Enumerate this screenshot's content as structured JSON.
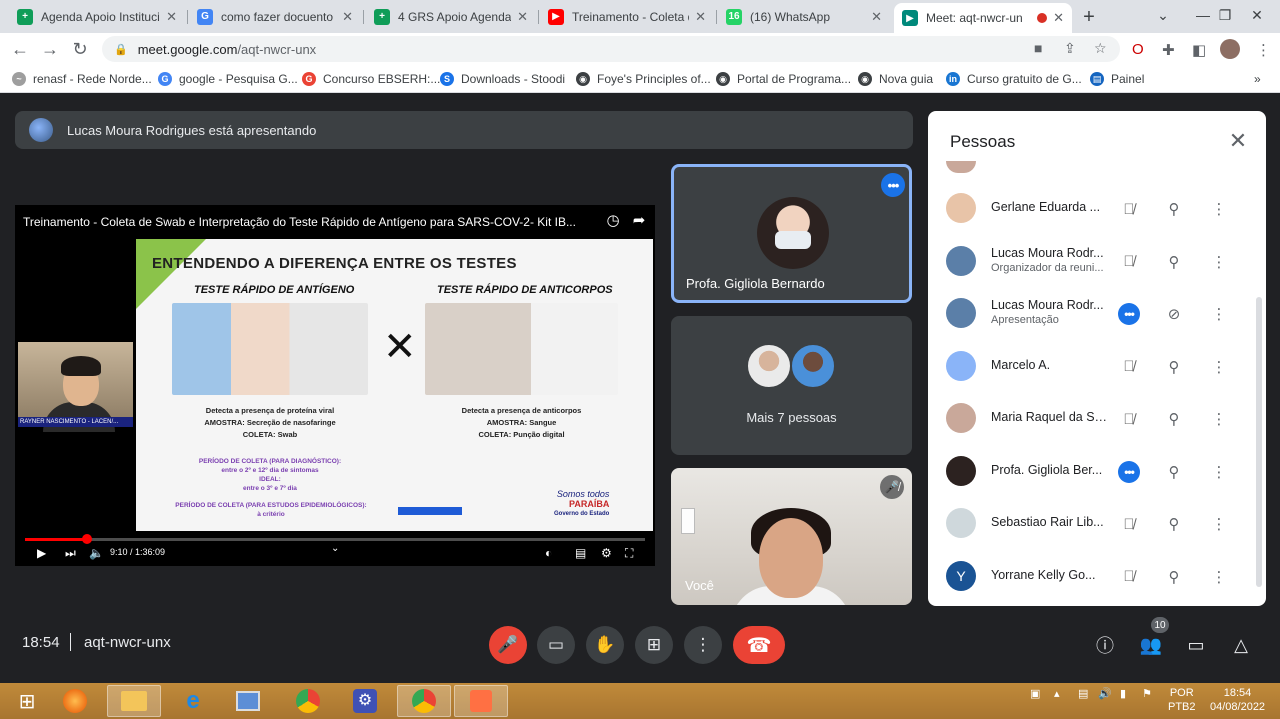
{
  "browser": {
    "tabs": [
      {
        "title": "Agenda Apoio Instituci",
        "favicon": "sheets-icon",
        "color": "#0f9d58",
        "glyph": "+"
      },
      {
        "title": "como fazer docuento d",
        "favicon": "google-icon",
        "color": "#4285f4",
        "glyph": "G"
      },
      {
        "title": "4 GRS Apoio Agenda co",
        "favicon": "sheets-icon",
        "color": "#0f9d58",
        "glyph": "+"
      },
      {
        "title": "Treinamento - Coleta de",
        "favicon": "youtube-icon",
        "color": "#ff0000",
        "glyph": "▶"
      },
      {
        "title": "(16) WhatsApp",
        "favicon": "whatsapp-icon",
        "color": "#25d366",
        "glyph": "16"
      },
      {
        "title": "Meet: aqt-nwcr-un",
        "favicon": "meet-icon",
        "color": "#00897b",
        "glyph": "▶"
      }
    ],
    "url_host": "meet.google.com",
    "url_path": "/aqt-nwcr-unx",
    "bookmarks": [
      {
        "label": "renasf - Rede Norde...",
        "color": "#9e9e9e",
        "glyph": "~"
      },
      {
        "label": "google - Pesquisa G...",
        "color": "#4285f4",
        "glyph": "G"
      },
      {
        "label": "Concurso EBSERH:...",
        "color": "#ea4335",
        "glyph": "G"
      },
      {
        "label": "Downloads - Stoodi",
        "color": "#1a73e8",
        "glyph": "S"
      },
      {
        "label": "Foye's Principles of...",
        "color": "#3c4043",
        "glyph": "◉"
      },
      {
        "label": "Portal de Programa...",
        "color": "#3c4043",
        "glyph": "◉"
      },
      {
        "label": "Nova guia",
        "color": "#3c4043",
        "glyph": "◉"
      },
      {
        "label": "Curso gratuito de G...",
        "color": "#1976d2",
        "glyph": "in"
      },
      {
        "label": "Painel",
        "color": "#1565c0",
        "glyph": "▤"
      }
    ],
    "more_bookmarks": "»"
  },
  "meet": {
    "presenting_text": "Lucas Moura Rodrigues está apresentando",
    "video": {
      "title": "Treinamento - Coleta de Swab e Interpretação do Teste Rápido de Antígeno para SARS-COV-2- Kit IB...",
      "time": "9:10 / 1:36:09",
      "progress": 0.1,
      "pip_label": "RAYNER NASCIMENTO - LACEN/..."
    },
    "slide": {
      "heading": "ENTENDENDO A DIFERENÇA ENTRE OS TESTES",
      "left_title": "TESTE RÁPIDO DE ANTÍGENO",
      "right_title": "TESTE RÁPIDO DE ANTICORPOS",
      "vs": "✕",
      "left_text": [
        "Detecta a presença de proteína viral",
        "AMOSTRA: Secreção de nasofaringe",
        "COLETA: Swab"
      ],
      "right_text": [
        "Detecta a presença de anticorpos",
        "AMOSTRA: Sangue",
        "COLETA: Punção digital"
      ],
      "period": [
        "PERÍODO DE COLETA (PARA DIAGNÓSTICO):",
        "entre o 2º e 12º dia de sintomas",
        "IDEAL:",
        "entre o 3º e 7º dia"
      ],
      "period2": [
        "PERÍODO DE COLETA (PARA ESTUDOS EPIDEMIOLÓGICOS):",
        "à critério"
      ],
      "logo": [
        "Somos todos",
        "PARAÍBA",
        "Governo do Estado"
      ]
    },
    "tiles": {
      "pinned_name": "Profa. Gigliola Bernardo",
      "others_label": "Mais 7 pessoas",
      "self_name": "Você"
    },
    "people_panel": {
      "title": "Pessoas",
      "rows": [
        {
          "name": "Gerlane Eduarda ...",
          "sub": "",
          "av": "#e8c4a8",
          "glyph": "",
          "mic": "muted",
          "dots": false
        },
        {
          "name": "Lucas Moura Rodr...",
          "sub": "Organizador da reuni...",
          "av": "#5b7fa8",
          "glyph": "",
          "mic": "muted",
          "dots": false
        },
        {
          "name": "Lucas Moura Rodr...",
          "sub": "Apresentação",
          "av": "#5b7fa8",
          "glyph": "",
          "mic": "active",
          "dots": true
        },
        {
          "name": "Marcelo A.",
          "sub": "",
          "av": "#8ab4f8",
          "glyph": "",
          "mic": "muted",
          "dots": false
        },
        {
          "name": "Maria Raquel da Sil...",
          "sub": "",
          "av": "#c9a89a",
          "glyph": "",
          "mic": "muted",
          "dots": false
        },
        {
          "name": "Profa. Gigliola Ber...",
          "sub": "",
          "av": "#2c2220",
          "glyph": "",
          "mic": "active",
          "dots": true
        },
        {
          "name": "Sebastiao Rair Lib...",
          "sub": "",
          "av": "#cfd8dc",
          "glyph": "",
          "mic": "muted",
          "dots": false
        },
        {
          "name": "Yorrane Kelly Go...",
          "sub": "",
          "av": "#1a5394",
          "glyph": "Y",
          "mic": "muted",
          "dots": false
        }
      ]
    },
    "bottom": {
      "clock": "18:54",
      "meeting_code": "aqt-nwcr-unx",
      "participants_count": "10"
    }
  },
  "taskbar": {
    "lang": "POR",
    "layout": "PTB2",
    "time": "18:54",
    "date": "04/08/2022"
  }
}
